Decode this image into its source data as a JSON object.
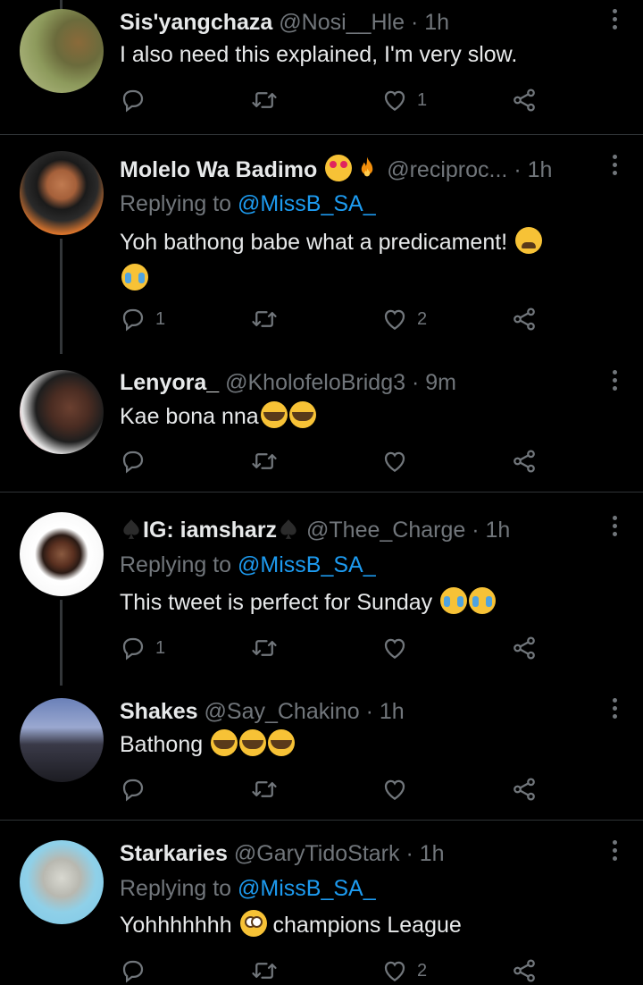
{
  "tweets": [
    {
      "name": "Sis'yangchaza",
      "handle": "@Nosi__Hle",
      "sep": "·",
      "time": "1h",
      "text": "I also need this explained, I'm very slow.",
      "counts": {
        "reply": "",
        "retweet": "",
        "like": "1"
      }
    },
    {
      "name": "Molelo Wa Badimo",
      "handle": "@reciproc...",
      "sep": "·",
      "time": "1h",
      "replying_label": "Replying to",
      "replying_to": "@MissB_SA_",
      "text": "Yoh bathong babe what a predicament!",
      "counts": {
        "reply": "1",
        "retweet": "",
        "like": "2"
      }
    },
    {
      "name": "Lenyora_",
      "handle": "@KholofeloBridg3",
      "sep": "·",
      "time": "9m",
      "text": "Kae bona nna",
      "counts": {
        "reply": "",
        "retweet": "",
        "like": ""
      }
    },
    {
      "name": "IG: iamsharz",
      "handle": "@Thee_Charge",
      "sep": "·",
      "time": "1h",
      "replying_label": "Replying to",
      "replying_to": "@MissB_SA_",
      "text": "This tweet is perfect for Sunday",
      "counts": {
        "reply": "1",
        "retweet": "",
        "like": ""
      }
    },
    {
      "name": "Shakes",
      "handle": "@Say_Chakino",
      "sep": "·",
      "time": "1h",
      "text": "Bathong",
      "counts": {
        "reply": "",
        "retweet": "",
        "like": ""
      }
    },
    {
      "name": "Starkaries",
      "handle": "@GaryTidoStark",
      "sep": "·",
      "time": "1h",
      "replying_label": "Replying to",
      "replying_to": "@MissB_SA_",
      "text": "Yohhhhhhh",
      "text_after": "champions League",
      "counts": {
        "reply": "",
        "retweet": "",
        "like": "2"
      }
    }
  ],
  "icons": {
    "reply": "reply-icon",
    "retweet": "retweet-icon",
    "like": "heart-icon",
    "share": "share-icon",
    "more": "more-icon"
  },
  "colors": {
    "background": "#000000",
    "text": "#e7e9ea",
    "muted": "#71767b",
    "link": "#1d9bf0",
    "divider": "#2f3336"
  }
}
